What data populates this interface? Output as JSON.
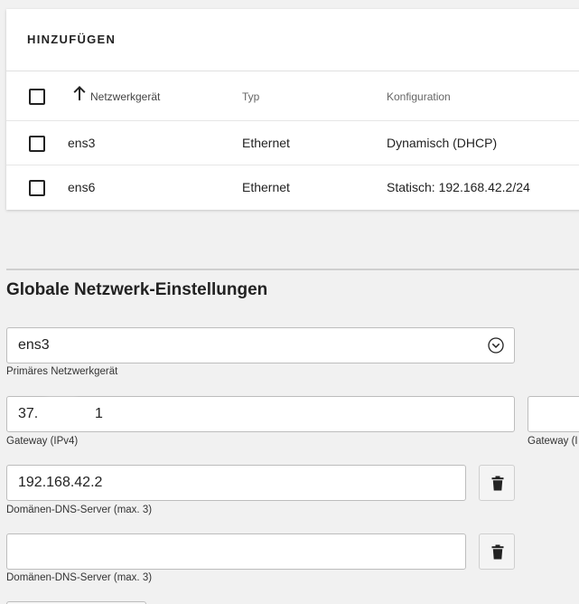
{
  "table": {
    "add_label": "HINZUFÜGEN",
    "columns": {
      "device": "Netzwerkgerät",
      "type": "Typ",
      "config": "Konfiguration"
    },
    "rows": [
      {
        "device": "ens3",
        "type": "Ethernet",
        "config": "Dynamisch (DHCP)"
      },
      {
        "device": "ens6",
        "type": "Ethernet",
        "config": "Statisch: 192.168.42.2/24"
      }
    ]
  },
  "global": {
    "title": "Globale Netzwerk-Einstellungen",
    "primary_device": {
      "value": "ens3",
      "help": "Primäres Netzwerkgerät"
    },
    "gateway_v4": {
      "value_prefix": "37.",
      "value_suffix": "1",
      "help": "Gateway (IPv4)"
    },
    "gateway_v6": {
      "value": "",
      "help": "Gateway (I"
    },
    "dns": [
      {
        "value": "192.168.42.2",
        "help": "Domänen-DNS-Server (max. 3)"
      },
      {
        "value": "",
        "help": "Domänen-DNS-Server (max. 3)"
      }
    ]
  },
  "icons": {
    "sort": "arrow-up-icon",
    "select": "chevron-down-circle-icon",
    "delete": "trash-icon"
  }
}
